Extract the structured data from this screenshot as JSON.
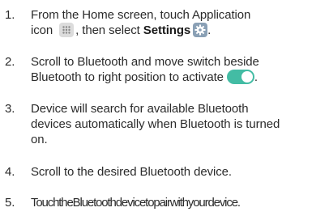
{
  "steps": [
    {
      "number": "1.",
      "line1": "From the Home screen, touch Application",
      "line2_pre": "icon",
      "line2_mid": ", then select",
      "line2_bold": "Settings",
      "line2_end": ".",
      "icons": [
        "apps-grid-icon",
        "settings-gear-icon"
      ]
    },
    {
      "number": "2.",
      "line1": "Scroll to Bluetooth and move switch  beside",
      "line2": "Bluetooth to right position to activate",
      "line2_end": ".",
      "icons": [
        "toggle-switch-icon"
      ]
    },
    {
      "number": "3.",
      "line1": "Device will search for available Bluetooth",
      "line2": "devices automatically when Bluetooth is turned",
      "line3": "on."
    },
    {
      "number": "4.",
      "line1": "Scroll to the desired Bluetooth device."
    },
    {
      "number": "5.",
      "line1": "TouchtheBluetoothdevicetopairwithyourdevice."
    }
  ],
  "colors": {
    "text": "#2b2b2b",
    "toggle": "#43bca4",
    "settings_icon": "#8aa0b5",
    "apps_icon": "#dcdcdc"
  }
}
